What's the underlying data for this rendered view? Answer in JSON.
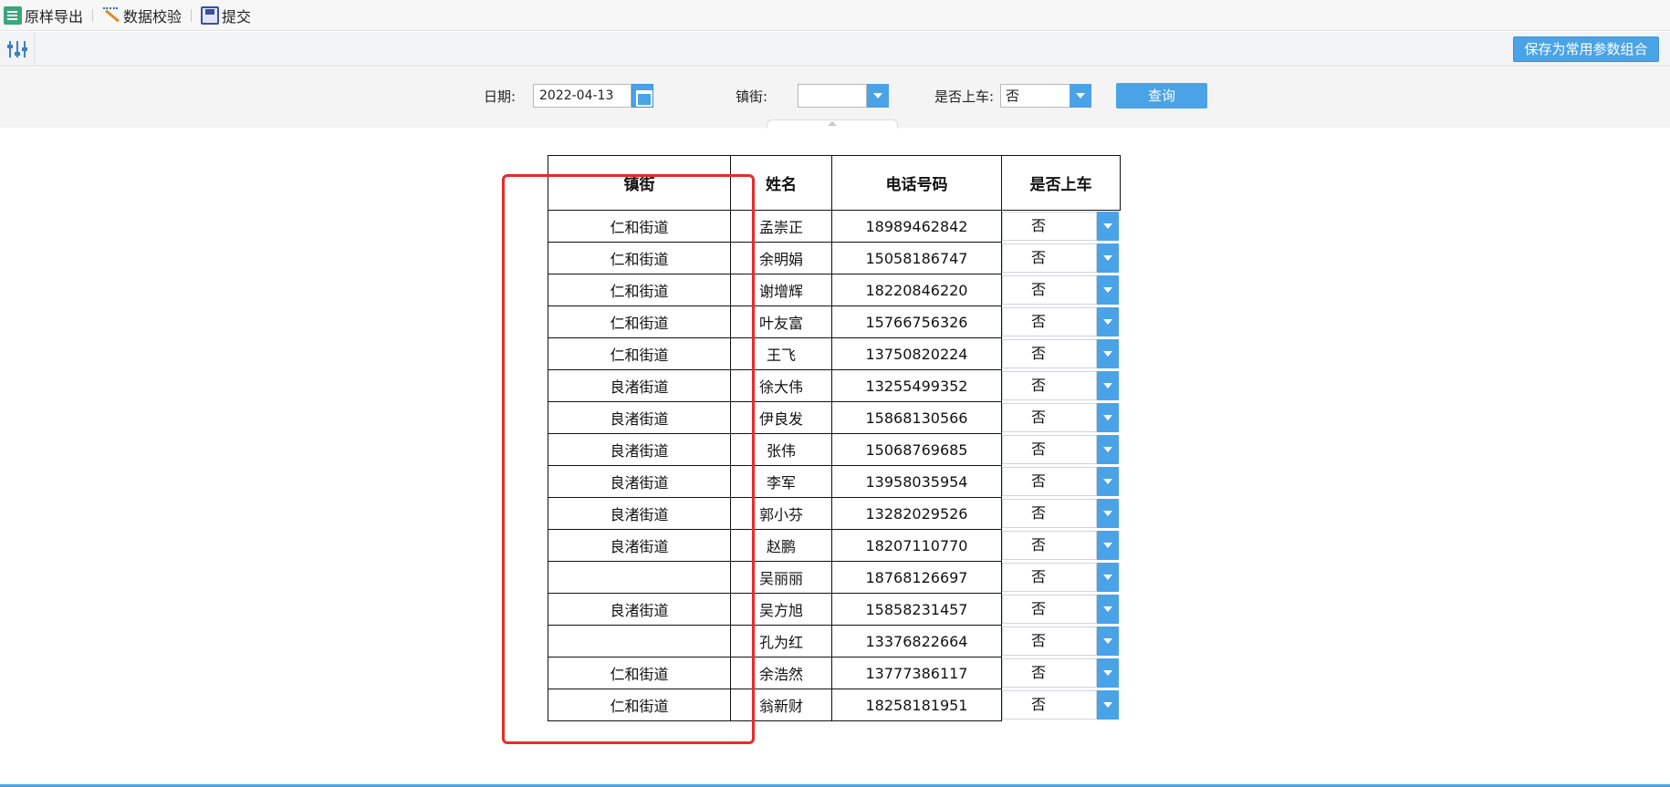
{
  "toolbar": {
    "export_label": "原样导出",
    "validate_label": "数据校验",
    "submit_label": "提交"
  },
  "parambar": {
    "save_combo_label": "保存为常用参数组合"
  },
  "query": {
    "date_label": "日期:",
    "date_value": "2022-04-13",
    "town_label": "镇街:",
    "town_value": "",
    "onboard_label": "是否上车:",
    "onboard_value": "否",
    "query_label": "查询"
  },
  "table": {
    "headers": [
      "镇街",
      "姓名",
      "电话号码",
      "是否上车"
    ],
    "rows": [
      {
        "town": "仁和街道",
        "name": "孟崇正",
        "phone": "18989462842",
        "board": "否"
      },
      {
        "town": "仁和街道",
        "name": "余明娟",
        "phone": "15058186747",
        "board": "否"
      },
      {
        "town": "仁和街道",
        "name": "谢增辉",
        "phone": "18220846220",
        "board": "否"
      },
      {
        "town": "仁和街道",
        "name": "叶友富",
        "phone": "15766756326",
        "board": "否"
      },
      {
        "town": "仁和街道",
        "name": "王飞",
        "phone": "13750820224",
        "board": "否"
      },
      {
        "town": "良渚街道",
        "name": "徐大伟",
        "phone": "13255499352",
        "board": "否"
      },
      {
        "town": "良渚街道",
        "name": "伊良发",
        "phone": "15868130566",
        "board": "否"
      },
      {
        "town": "良渚街道",
        "name": "张伟",
        "phone": "15068769685",
        "board": "否"
      },
      {
        "town": "良渚街道",
        "name": "李军",
        "phone": "13958035954",
        "board": "否"
      },
      {
        "town": "良渚街道",
        "name": "郭小芬",
        "phone": "13282029526",
        "board": "否"
      },
      {
        "town": "良渚街道",
        "name": "赵鹏",
        "phone": "18207110770",
        "board": "否"
      },
      {
        "town": "",
        "name": "吴丽丽",
        "phone": "18768126697",
        "board": "否"
      },
      {
        "town": "良渚街道",
        "name": "吴方旭",
        "phone": "15858231457",
        "board": "否"
      },
      {
        "town": "",
        "name": "孔为红",
        "phone": "13376822664",
        "board": "否"
      },
      {
        "town": "仁和街道",
        "name": "余浩然",
        "phone": "13777386117",
        "board": "否"
      },
      {
        "town": "仁和街道",
        "name": "翁新财",
        "phone": "18258181951",
        "board": "否"
      }
    ]
  },
  "colors": {
    "accent": "#4aa3e6",
    "highlight": "#e82a2a"
  }
}
